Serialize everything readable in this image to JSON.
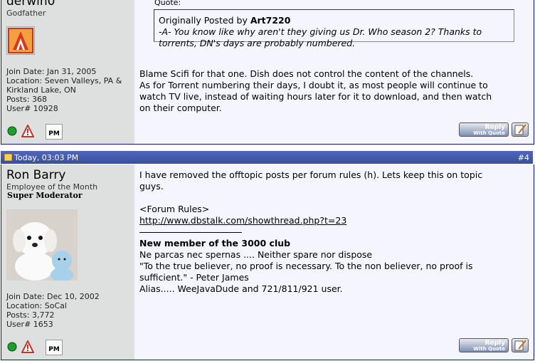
{
  "post1": {
    "username": "derwin0",
    "usertitle": "Godfather",
    "join_date": "Join Date: Jan 31, 2005",
    "location_1": "Location: Seven Valleys, PA &",
    "location_2": "Kirkland Lake, ON",
    "posts": "Posts: 368",
    "user_num": "User# 10928",
    "quote_label": "Quote:",
    "quote_prefix": "Originally Posted by ",
    "quote_author": "Art7220",
    "quote_text_1": "-A- You know like why aren't they giving us Dr. Who season 2? Thanks to",
    "quote_text_2": "torrents, DN's days are probably numbered.",
    "message": [
      "Blame Scifi for that one. Dish does not control the content of the channels.",
      "As for Torrent numbering their days, I doubt it, as most people will continue to",
      "watch TV live, instead of waiting hours later for it to download, and then watch",
      "on their computer."
    ],
    "reply_label": "Reply",
    "reply_sub": "With Quote"
  },
  "post2": {
    "date": "Today, 03:03 PM",
    "post_number": "#4",
    "username": "Ron Barry",
    "usertitle": "Employee of the Month",
    "rank": "Super Moderator",
    "join_date": "Join Date: Dec 10, 2002",
    "location": "Location: SoCal",
    "posts": "Posts: 3,772",
    "user_num": "User# 1653",
    "message_1": "I have removed the offtopic posts per forum rules (h). Lets keep this on topic",
    "message_2": "guys.",
    "rules_label": "<Forum Rules>",
    "rules_link": "http://www.dbstalk.com/showthread.php?t=23",
    "sig_title": "New member of the 3000 club",
    "sig_1": "Ne parcas nec spernas .... Neither spare nor dispose",
    "sig_2": "\"To the true believer, no proof is necessary. To the non believer, no proof is",
    "sig_3": "sufficient.\" - Peter James",
    "sig_4": "Alias..... WeeJavaDude and 721/811/921 user.",
    "reply_label": "Reply",
    "reply_sub": "With Quote"
  },
  "pm_label": "PM",
  "colors": {
    "header": "#3a4fa0",
    "sidebar": "#dedfdf",
    "post_bg": "#f5f5ff",
    "border": "#0b198c"
  }
}
